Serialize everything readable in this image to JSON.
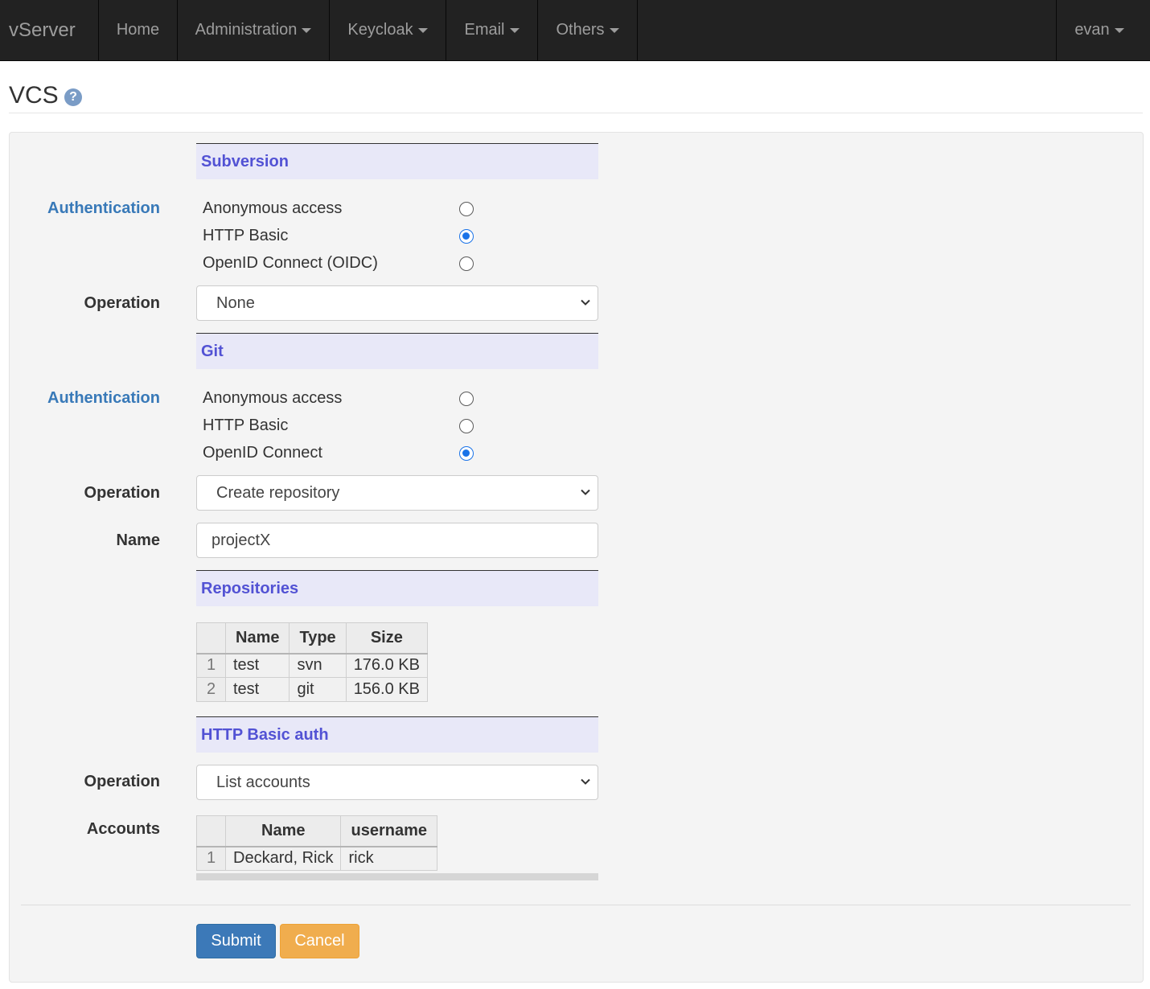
{
  "navbar": {
    "brand": "vServer",
    "items": [
      "Home",
      "Administration",
      "Keycloak",
      "Email",
      "Others"
    ],
    "user": "evan"
  },
  "page": {
    "title": "VCS",
    "help_icon": "question-circle-icon"
  },
  "subversion": {
    "heading": "Subversion",
    "auth_label": "Authentication",
    "auth_options": [
      "Anonymous access",
      "HTTP Basic",
      "OpenID Connect (OIDC)"
    ],
    "auth_selected": "HTTP Basic",
    "operation_label": "Operation",
    "operation_value": "None"
  },
  "git": {
    "heading": "Git",
    "auth_label": "Authentication",
    "auth_options": [
      "Anonymous access",
      "HTTP Basic",
      "OpenID Connect"
    ],
    "auth_selected": "OpenID Connect",
    "operation_label": "Operation",
    "operation_value": "Create repository",
    "name_label": "Name",
    "name_value": "projectX"
  },
  "repositories": {
    "heading": "Repositories",
    "columns": [
      "Name",
      "Type",
      "Size"
    ],
    "rows": [
      {
        "idx": "1",
        "name": "test",
        "type": "svn",
        "size": "176.0 KB"
      },
      {
        "idx": "2",
        "name": "test",
        "type": "git",
        "size": "156.0 KB"
      }
    ]
  },
  "http_basic_auth": {
    "heading": "HTTP Basic auth",
    "operation_label": "Operation",
    "operation_value": "List accounts",
    "accounts_label": "Accounts",
    "columns": [
      "Name",
      "username"
    ],
    "rows": [
      {
        "idx": "1",
        "name": "Deckard, Rick",
        "username": "rick"
      }
    ]
  },
  "buttons": {
    "submit": "Submit",
    "cancel": "Cancel"
  },
  "colors": {
    "navbar_bg": "#222222",
    "section_heading": "#5252d4",
    "auth_label": "#3879b8",
    "primary": "#3c79b8",
    "warning": "#f0ad4e"
  }
}
